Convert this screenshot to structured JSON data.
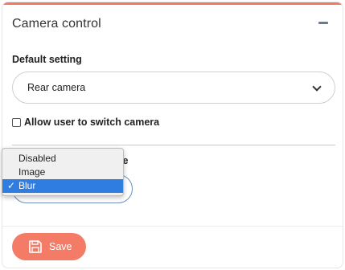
{
  "panel": {
    "title": "Camera control",
    "accent_color": "#f07a5e"
  },
  "default_setting": {
    "label": "Default setting",
    "value": "Rear camera"
  },
  "allow_switch": {
    "label": "Allow user to switch camera",
    "checked": false
  },
  "background": {
    "label_tail": "le"
  },
  "dropdown": {
    "options": [
      "Disabled",
      "Image",
      "Blur"
    ],
    "selected": "Blur",
    "selected_mark": "✓"
  },
  "save_button": {
    "label": "Save",
    "color": "#f47c66",
    "icon": "save-icon"
  }
}
